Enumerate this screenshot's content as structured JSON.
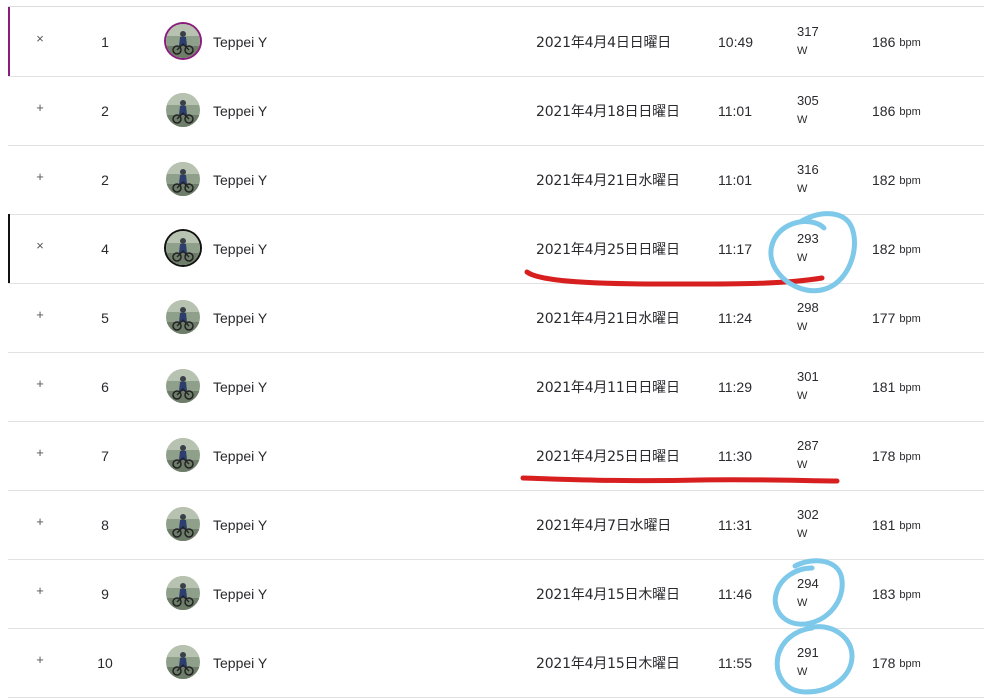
{
  "leaderboard": {
    "rows": [
      {
        "toggle": "×",
        "rank": "1",
        "name": "Teppei Y",
        "date": "2021年4月4日日曜日",
        "time": "10:49",
        "power": "317",
        "power_unit": "W",
        "hr": "186",
        "hr_unit": "bpm",
        "accent": "#8a1c7c",
        "avatar_ring": "purple"
      },
      {
        "toggle": "+",
        "rank": "2",
        "name": "Teppei Y",
        "date": "2021年4月18日日曜日",
        "time": "11:01",
        "power": "305",
        "power_unit": "W",
        "hr": "186",
        "hr_unit": "bpm",
        "accent": "",
        "avatar_ring": "none"
      },
      {
        "toggle": "+",
        "rank": "2",
        "name": "Teppei Y",
        "date": "2021年4月21日水曜日",
        "time": "11:01",
        "power": "316",
        "power_unit": "W",
        "hr": "182",
        "hr_unit": "bpm",
        "accent": "",
        "avatar_ring": "none"
      },
      {
        "toggle": "×",
        "rank": "4",
        "name": "Teppei Y",
        "date": "2021年4月25日日曜日",
        "time": "11:17",
        "power": "293",
        "power_unit": "W",
        "hr": "182",
        "hr_unit": "bpm",
        "accent": "#111111",
        "avatar_ring": "black"
      },
      {
        "toggle": "+",
        "rank": "5",
        "name": "Teppei Y",
        "date": "2021年4月21日水曜日",
        "time": "11:24",
        "power": "298",
        "power_unit": "W",
        "hr": "177",
        "hr_unit": "bpm",
        "accent": "",
        "avatar_ring": "none"
      },
      {
        "toggle": "+",
        "rank": "6",
        "name": "Teppei Y",
        "date": "2021年4月11日日曜日",
        "time": "11:29",
        "power": "301",
        "power_unit": "W",
        "hr": "181",
        "hr_unit": "bpm",
        "accent": "",
        "avatar_ring": "none"
      },
      {
        "toggle": "+",
        "rank": "7",
        "name": "Teppei Y",
        "date": "2021年4月25日日曜日",
        "time": "11:30",
        "power": "287",
        "power_unit": "W",
        "hr": "178",
        "hr_unit": "bpm",
        "accent": "",
        "avatar_ring": "none"
      },
      {
        "toggle": "+",
        "rank": "8",
        "name": "Teppei Y",
        "date": "2021年4月7日水曜日",
        "time": "11:31",
        "power": "302",
        "power_unit": "W",
        "hr": "181",
        "hr_unit": "bpm",
        "accent": "",
        "avatar_ring": "none"
      },
      {
        "toggle": "+",
        "rank": "9",
        "name": "Teppei Y",
        "date": "2021年4月15日木曜日",
        "time": "11:46",
        "power": "294",
        "power_unit": "W",
        "hr": "183",
        "hr_unit": "bpm",
        "accent": "",
        "avatar_ring": "none"
      },
      {
        "toggle": "+",
        "rank": "10",
        "name": "Teppei Y",
        "date": "2021年4月15日木曜日",
        "time": "11:55",
        "power": "291",
        "power_unit": "W",
        "hr": "178",
        "hr_unit": "bpm",
        "accent": "",
        "avatar_ring": "none"
      }
    ]
  },
  "annotations": {
    "underline_color": "#d81f1f",
    "circle_color": "#7ec8ea"
  }
}
